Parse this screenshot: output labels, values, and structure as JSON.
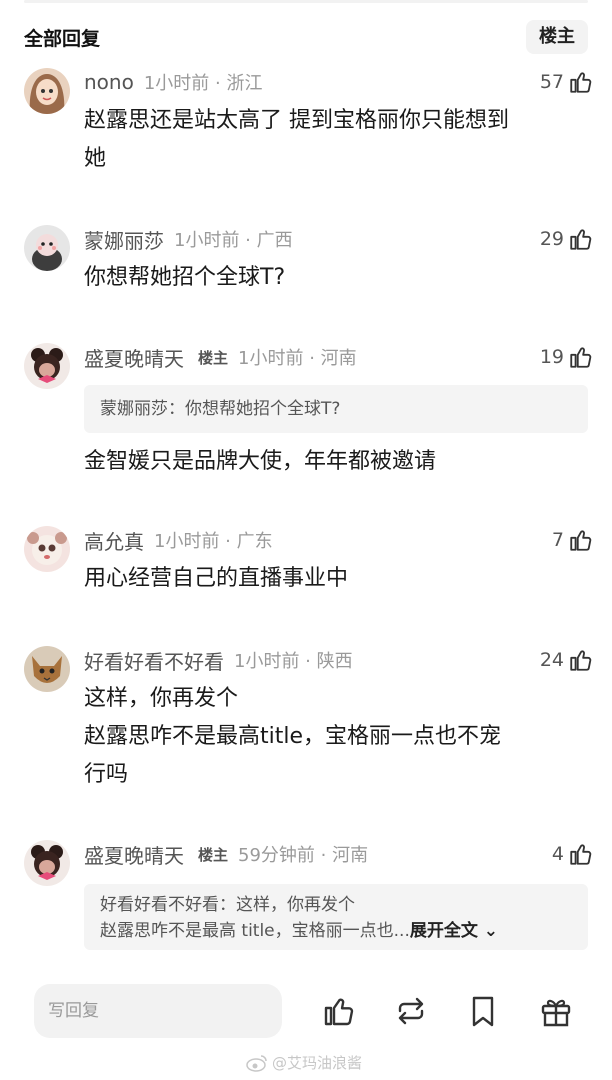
{
  "header": {
    "title": "全部回复",
    "op_tag": "楼主"
  },
  "comments": [
    {
      "user": "nono",
      "badge": "",
      "time": "1小时前 · 浙江",
      "likes": "57",
      "lines": [
        "赵露思还是站太高了 提到宝格丽你只能想到",
        "她"
      ],
      "quote": []
    },
    {
      "user": "蒙娜丽莎",
      "badge": "",
      "time": "1小时前 · 广西",
      "likes": "29",
      "lines": [
        "你想帮她招个全球T?"
      ],
      "quote": []
    },
    {
      "user": "盛夏晚晴天",
      "badge": "楼主",
      "time": "1小时前 · 河南",
      "likes": "19",
      "quote": [
        "蒙娜丽莎：你想帮她招个全球T?"
      ],
      "lines": [
        "金智媛只是品牌大使，年年都被邀请"
      ]
    },
    {
      "user": "高允真",
      "badge": "",
      "time": "1小时前 · 广东",
      "likes": "7",
      "lines": [
        "用心经营自己的直播事业中"
      ],
      "quote": []
    },
    {
      "user": "好看好看不好看",
      "badge": "",
      "time": "1小时前 · 陕西",
      "likes": "24",
      "lines": [
        "这样，你再发个",
        "赵露思咋不是最高title，宝格丽一点也不宠",
        "行吗"
      ],
      "quote": []
    },
    {
      "user": "盛夏晚晴天",
      "badge": "楼主",
      "time": "59分钟前 · 河南",
      "likes": "4",
      "quote": [
        "好看好看不好看：这样，你再发个",
        "赵露思咋不是最高 title，宝格丽一点也..."
      ],
      "expand": "展开全文",
      "lines": []
    }
  ],
  "bottom": {
    "reply_placeholder": "写回复",
    "actions": [
      "like-icon",
      "repost-icon",
      "bookmark-icon",
      "gift-icon"
    ],
    "watermark": "@艾玛油浪酱"
  }
}
